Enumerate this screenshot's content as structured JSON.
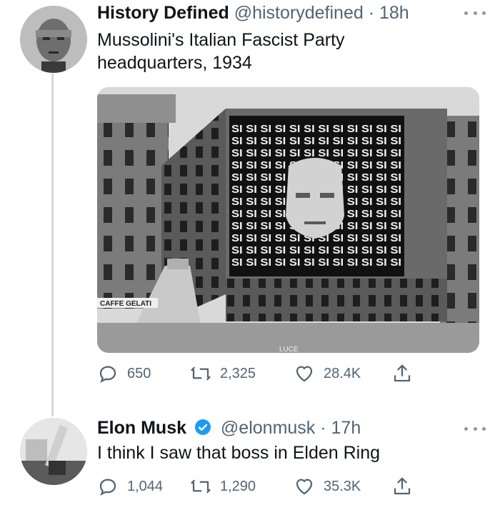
{
  "tweets": [
    {
      "name": "History Defined",
      "handle": "@historydefined",
      "separator": "·",
      "time": "18h",
      "text_lines": [
        "Mussolini's Italian Fascist Party",
        "headquarters, 1934"
      ],
      "image_text": {
        "banner_word": "SI",
        "shop_sign": "CAFFE GELATI",
        "street_sign": "LUCE"
      },
      "stats": {
        "replies": "650",
        "retweets": "2,325",
        "likes": "28.4K"
      },
      "icons": [
        "reply-icon",
        "retweet-icon",
        "like-icon",
        "share-icon"
      ]
    },
    {
      "name": "Elon Musk",
      "verified": true,
      "handle": "@elonmusk",
      "separator": "·",
      "time": "17h",
      "text": "I think I saw that boss in Elden Ring",
      "stats": {
        "replies": "1,044",
        "retweets": "1,290",
        "likes": "35.3K"
      },
      "icons": [
        "reply-icon",
        "retweet-icon",
        "like-icon",
        "share-icon"
      ]
    }
  ],
  "colors": {
    "text": "#0f1419",
    "secondary": "#536471",
    "thread_line": "#cfd9de",
    "verified_blue": "#1d9bf0"
  }
}
